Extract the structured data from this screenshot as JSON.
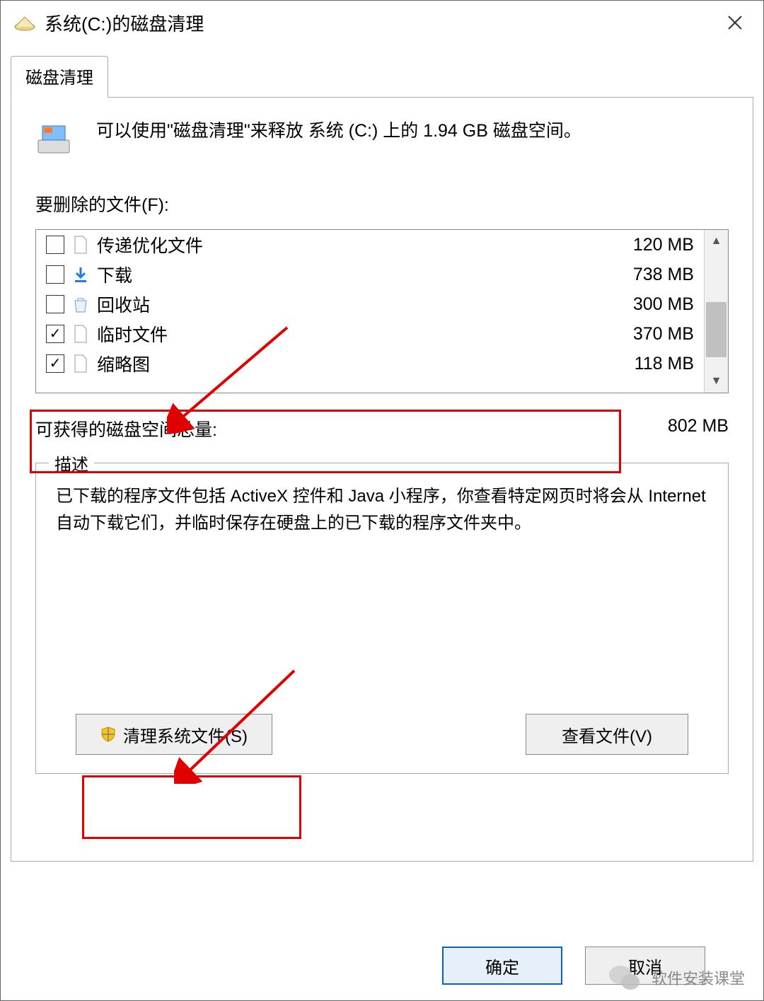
{
  "window": {
    "title": "系统(C:)的磁盘清理"
  },
  "tab": {
    "label": "磁盘清理"
  },
  "summary": "可以使用\"磁盘清理\"来释放 系统 (C:) 上的 1.94 GB 磁盘空间。",
  "files_to_delete_label": "要删除的文件(F):",
  "file_items": [
    {
      "label": "传递优化文件",
      "size": "120 MB",
      "checked": false,
      "icon": "file"
    },
    {
      "label": "下载",
      "size": "738 MB",
      "checked": false,
      "icon": "download"
    },
    {
      "label": "回收站",
      "size": "300 MB",
      "checked": false,
      "icon": "recycle"
    },
    {
      "label": "临时文件",
      "size": "370 MB",
      "checked": true,
      "icon": "file"
    },
    {
      "label": "缩略图",
      "size": "118 MB",
      "checked": true,
      "icon": "file"
    }
  ],
  "gain": {
    "label": "可获得的磁盘空间总量:",
    "value": "802 MB"
  },
  "description": {
    "legend": "描述",
    "text": "已下载的程序文件包括 ActiveX 控件和 Java 小程序，你查看特定网页时将会从 Internet 自动下载它们，并临时保存在硬盘上的已下载的程序文件夹中。"
  },
  "buttons": {
    "cleanup_system": "清理系统文件(S)",
    "view_files": "查看文件(V)",
    "ok": "确定",
    "cancel": "取消"
  },
  "watermark": "软件安装课堂"
}
